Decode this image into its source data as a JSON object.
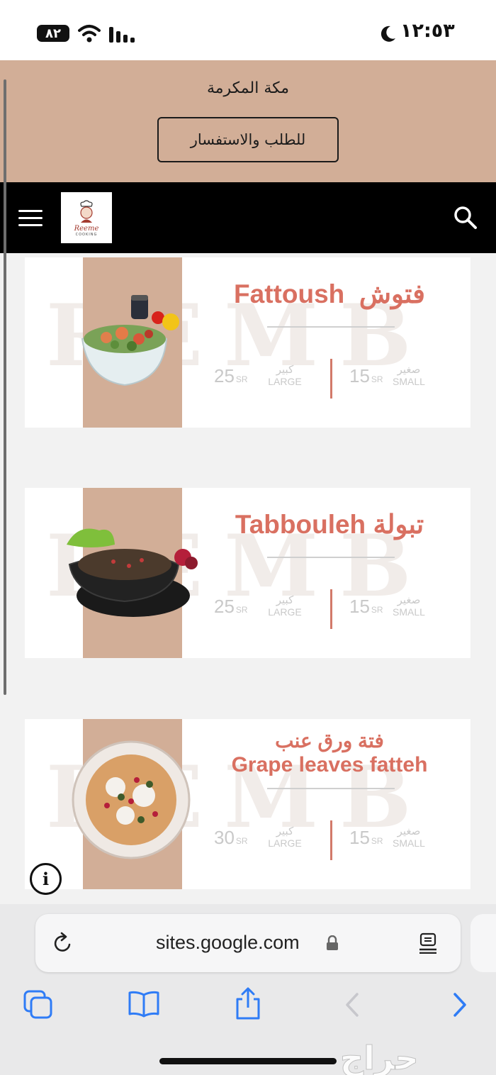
{
  "status_bar": {
    "battery": "٨٢",
    "time": "١٢:٥٣",
    "icons": [
      "battery-icon",
      "wifi-icon",
      "signal-icon",
      "moon-icon"
    ]
  },
  "site": {
    "city": "مكة المكرمة",
    "order_button": "للطلب والاستفسار",
    "logo_text": "Reeme",
    "logo_subtext": "COOKING",
    "nav_icons": [
      "menu-icon",
      "search-icon"
    ]
  },
  "menu_items": [
    {
      "title_en": "Fattoush",
      "title_ar": "فتوش",
      "large_price": "25",
      "small_price": "15",
      "currency": "SR",
      "large_ar": "كبير",
      "large_en": "LARGE",
      "small_ar": "صغير",
      "small_en": "SMALL"
    },
    {
      "title_en": "Tabbouleh",
      "title_ar": "تبولة",
      "large_price": "25",
      "small_price": "15",
      "currency": "SR",
      "large_ar": "كبير",
      "large_en": "LARGE",
      "small_ar": "صغير",
      "small_en": "SMALL"
    },
    {
      "title_en": "Grape leaves fatteh",
      "title_ar": "فتة ورق عنب",
      "large_price": "30",
      "small_price": "15",
      "currency": "SR",
      "large_ar": "كبير",
      "large_en": "LARGE",
      "small_ar": "صغير",
      "small_en": "SMALL"
    }
  ],
  "watermark": "REMB",
  "info_symbol": "i",
  "browser": {
    "url": "sites.google.com",
    "icons": [
      "reload-icon",
      "lock-icon",
      "reader-icon",
      "tabs-icon",
      "bookmarks-icon",
      "share-icon",
      "back-icon",
      "forward-icon"
    ]
  },
  "overlay_watermark": "حراج",
  "colors": {
    "accent": "#d97061",
    "beige": "#d2ae97",
    "ios_blue": "#2f7cf6"
  }
}
